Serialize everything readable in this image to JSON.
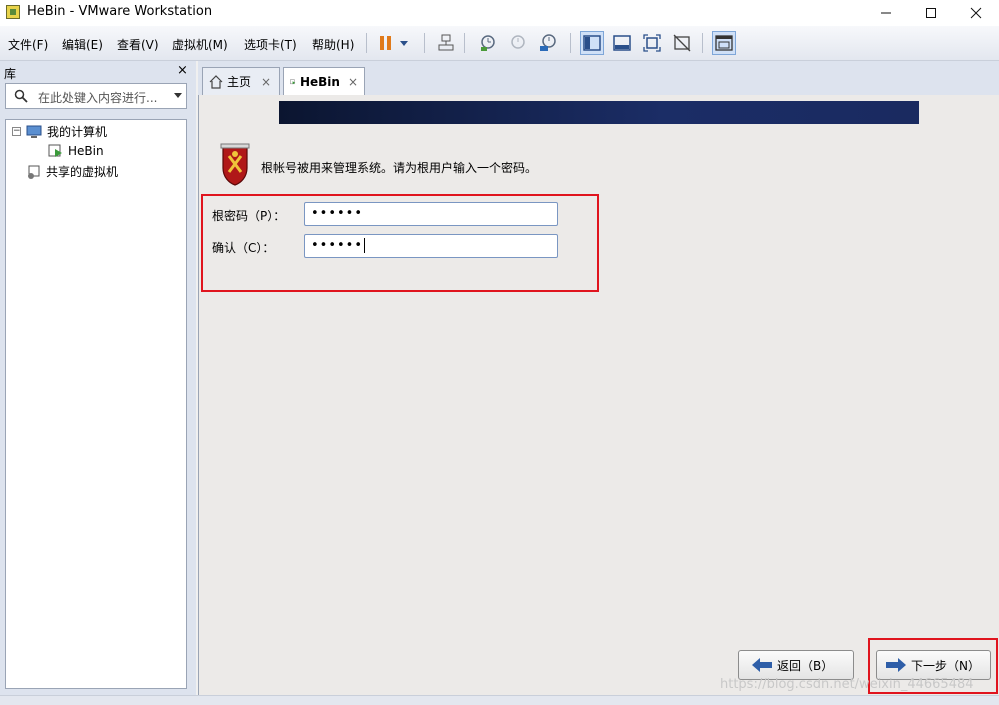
{
  "window": {
    "title": "HeBin - VMware Workstation"
  },
  "menu": {
    "items": [
      {
        "label": "文件(F)"
      },
      {
        "label": "编辑(E)"
      },
      {
        "label": "查看(V)"
      },
      {
        "label": "虚拟机(M)"
      },
      {
        "label": "选项卡(T)"
      },
      {
        "label": "帮助(H)"
      }
    ]
  },
  "library": {
    "title": "库",
    "close": "×",
    "search_placeholder": "在此处键入内容进行...",
    "tree": {
      "my_computer": "我的计算机",
      "vm": "HeBin",
      "shared": "共享的虚拟机"
    }
  },
  "tabs": [
    {
      "label": "主页",
      "close": "×"
    },
    {
      "label": "HeBin",
      "close": "×"
    }
  ],
  "installer": {
    "prompt": "根帐号被用来管理系统。请为根用户输入一个密码。",
    "root_password_label": "根密码（P）：",
    "root_password_value": "••••••",
    "confirm_label": "确认（C）：",
    "confirm_value": "••••••",
    "back_label": "返回（B）",
    "next_label": "下一步（N）"
  },
  "watermark": "https://blog.csdn.net/weixin_44665484",
  "colors": {
    "highlight": "#e0141e",
    "banner": "#12204a"
  }
}
